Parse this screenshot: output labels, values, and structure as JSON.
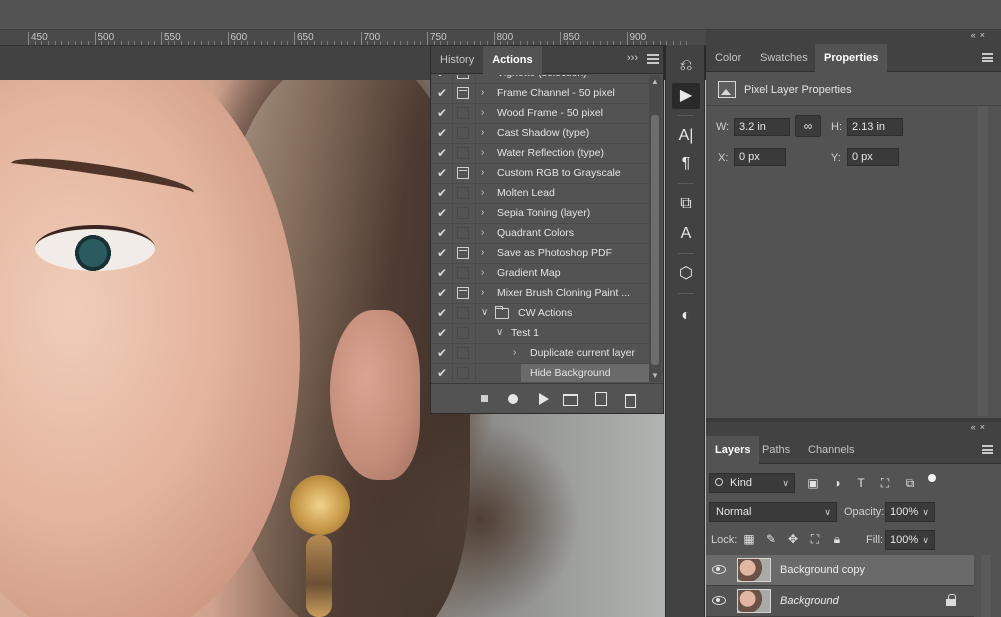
{
  "ruler": {
    "labels": [
      "450",
      "500",
      "550",
      "600",
      "650",
      "700",
      "750",
      "800",
      "850",
      "900"
    ]
  },
  "actions_panel": {
    "tabs": [
      {
        "label": "History"
      },
      {
        "label": "Actions"
      }
    ],
    "collapse_glyph": "›››",
    "rows": [
      {
        "label": "Vignette (selection)",
        "dialog": true,
        "indent": "set"
      },
      {
        "label": "Frame Channel - 50 pixel",
        "dialog": true,
        "indent": "set"
      },
      {
        "label": "Wood Frame - 50 pixel",
        "dialog": false,
        "indent": "set"
      },
      {
        "label": "Cast Shadow (type)",
        "dialog": false,
        "indent": "set"
      },
      {
        "label": "Water Reflection (type)",
        "dialog": false,
        "indent": "set"
      },
      {
        "label": "Custom RGB to Grayscale",
        "dialog": true,
        "indent": "set"
      },
      {
        "label": "Molten Lead",
        "dialog": false,
        "indent": "set"
      },
      {
        "label": "Sepia Toning (layer)",
        "dialog": false,
        "indent": "set"
      },
      {
        "label": "Quadrant Colors",
        "dialog": false,
        "indent": "set"
      },
      {
        "label": "Save as Photoshop PDF",
        "dialog": true,
        "indent": "set"
      },
      {
        "label": "Gradient Map",
        "dialog": false,
        "indent": "set"
      },
      {
        "label": "Mixer Brush Cloning Paint ...",
        "dialog": true,
        "indent": "set"
      },
      {
        "label": "CW Actions",
        "dialog": false,
        "indent": "folder"
      },
      {
        "label": "Test 1",
        "dialog": false,
        "indent": "action"
      },
      {
        "label": "Duplicate current layer",
        "dialog": false,
        "indent": "step"
      },
      {
        "label": "Hide Background",
        "dialog": false,
        "indent": "stepsel"
      }
    ]
  },
  "right_top_panel": {
    "tabs": [
      {
        "label": "Color"
      },
      {
        "label": "Swatches"
      },
      {
        "label": "Properties"
      }
    ],
    "title": "Pixel Layer Properties",
    "w_label": "W:",
    "w_value": "3.2 in",
    "h_label": "H:",
    "h_value": "2.13 in",
    "x_label": "X:",
    "x_value": "0 px",
    "y_label": "Y:",
    "y_value": "0 px"
  },
  "layers_panel": {
    "tabs": [
      {
        "label": "Layers"
      },
      {
        "label": "Paths"
      },
      {
        "label": "Channels"
      }
    ],
    "filter_kind": "Kind",
    "blend_mode": "Normal",
    "opacity_label": "Opacity:",
    "opacity_value": "100%",
    "lock_label": "Lock:",
    "fill_label": "Fill:",
    "fill_value": "100%",
    "layers": [
      {
        "name": "Background copy",
        "selected": true,
        "locked": false
      },
      {
        "name": "Background",
        "selected": false,
        "locked": true
      }
    ]
  },
  "icons": {
    "icon_column": [
      "history-brush-icon",
      "play-actions-icon",
      "character-icon",
      "paragraph-icon",
      "clone-source-icon",
      "glyphs-icon",
      "3d-cube-icon",
      "adjustments-icon"
    ]
  },
  "colors": {
    "panel_bg": "#535353",
    "tab_bg": "#424242",
    "selected_row": "#6a6a6a",
    "field_bg": "#3a3a3a"
  }
}
